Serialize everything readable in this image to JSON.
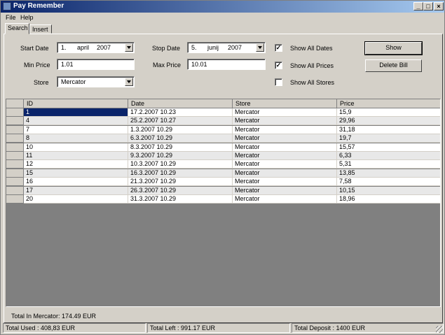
{
  "window": {
    "title": "Pay Remember"
  },
  "menu": {
    "file": "File",
    "help": "Help"
  },
  "tabs": {
    "search": "Search",
    "insert": "Insert"
  },
  "form": {
    "start_date_label": "Start Date",
    "start_date": {
      "day": "1.",
      "month": "april",
      "year": "2007"
    },
    "stop_date_label": "Stop Date",
    "stop_date": {
      "day": "5.",
      "month": "junij",
      "year": "2007"
    },
    "min_price_label": "Min Price",
    "min_price": "1.01",
    "max_price_label": "Max Price",
    "max_price": "10.01",
    "store_label": "Store",
    "store": "Mercator",
    "show_all_dates": {
      "label": "Show All Dates",
      "checked": true
    },
    "show_all_prices": {
      "label": "Show All Prices",
      "checked": true
    },
    "show_all_stores": {
      "label": "Show All Stores",
      "checked": false
    },
    "show_button": "Show",
    "delete_button": "Delete Bill"
  },
  "table": {
    "columns": [
      "ID",
      "Date",
      "Store",
      "Price"
    ],
    "rows": [
      [
        "1",
        "17.2.2007 10.23",
        "Mercator",
        "15,9"
      ],
      [
        "4",
        "25.2.2007 10.27",
        "Mercator",
        "29,96"
      ],
      [
        "7",
        "1.3.2007 10.29",
        "Mercator",
        "31,18"
      ],
      [
        "8",
        "6.3.2007 10.29",
        "Mercator",
        "19,7"
      ],
      [
        "10",
        "8.3.2007 10.29",
        "Mercator",
        "15,57"
      ],
      [
        "11",
        "9.3.2007 10.29",
        "Mercator",
        "6,33"
      ],
      [
        "12",
        "10.3.2007 10.29",
        "Mercator",
        "5,31"
      ],
      [
        "15",
        "16.3.2007 10.29",
        "Mercator",
        "13,85"
      ],
      [
        "16",
        "21.3.2007 10.29",
        "Mercator",
        "7,58"
      ],
      [
        "17",
        "26.3.2007 10.29",
        "Mercator",
        "10,15"
      ],
      [
        "20",
        "31.3.2007 10.29",
        "Mercator",
        "18,96"
      ]
    ]
  },
  "total_in_store": "Total In Mercator: 174.49 EUR",
  "status": {
    "used": "Total Used : 408,83 EUR",
    "left": "Total Left : 991.17 EUR",
    "deposit": "Total Deposit : 1400 EUR"
  }
}
